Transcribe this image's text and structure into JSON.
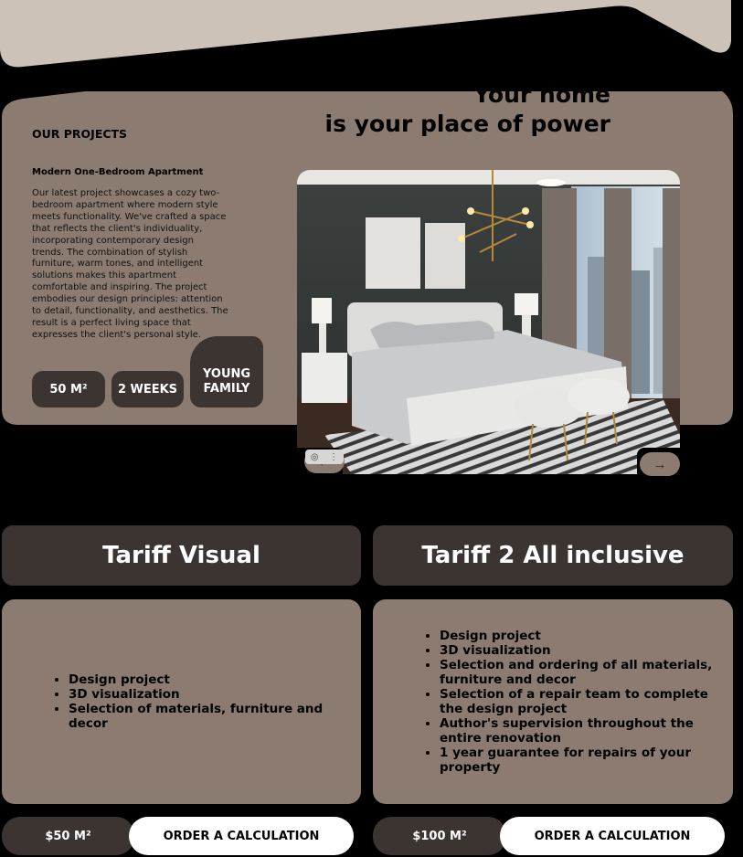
{
  "hero": {
    "slogan_line1": "Your home",
    "slogan_line2": "is your place of power"
  },
  "projects": {
    "section_title": "OUR PROJECTS",
    "project_title": "Modern One-Bedroom Apartment",
    "description": "Our latest project showcases a cozy two-bedroom apartment where modern style meets functionality. We've crafted a space that reflects the client's individuality, incorporating contemporary design trends. The combination of stylish furniture, warm tones, and intelligent solutions makes this apartment comfortable and inspiring. The project embodies our design principles: attention to detail, functionality, and aesthetics. The result is a perfect living space that expresses the client's personal style.",
    "badges": {
      "area": "50 M²",
      "duration": "2 WEEKS",
      "client": "YOUNG FAMILY"
    },
    "photo_alt": "Bedroom interior",
    "prev_icon": "arrow-left-icon",
    "next_icon": "arrow-right-icon"
  },
  "tariffs": [
    {
      "name": "Tariff Visual",
      "features": [
        "Design project",
        "3D visualization",
        "Selection of materials, furniture and decor"
      ],
      "price": "$50 M²",
      "order_label": "ORDER A CALCULATION"
    },
    {
      "name": "Tariff 2 All inclusive",
      "features": [
        "Design project",
        "3D visualization",
        "Selection and ordering of all materials, furniture and decor",
        "Selection of a repair team to complete the design project",
        "Author's supervision throughout the entire renovation",
        "1 year guarantee for repairs of your property"
      ],
      "price": "$100 M²",
      "order_label": "ORDER A CALCULATION"
    }
  ],
  "colors": {
    "background": "#000000",
    "panel_taupe": "#8b7b70",
    "panel_dark": "#3b3430",
    "top_beige": "#ccc2b8",
    "button_white": "#ffffff"
  }
}
